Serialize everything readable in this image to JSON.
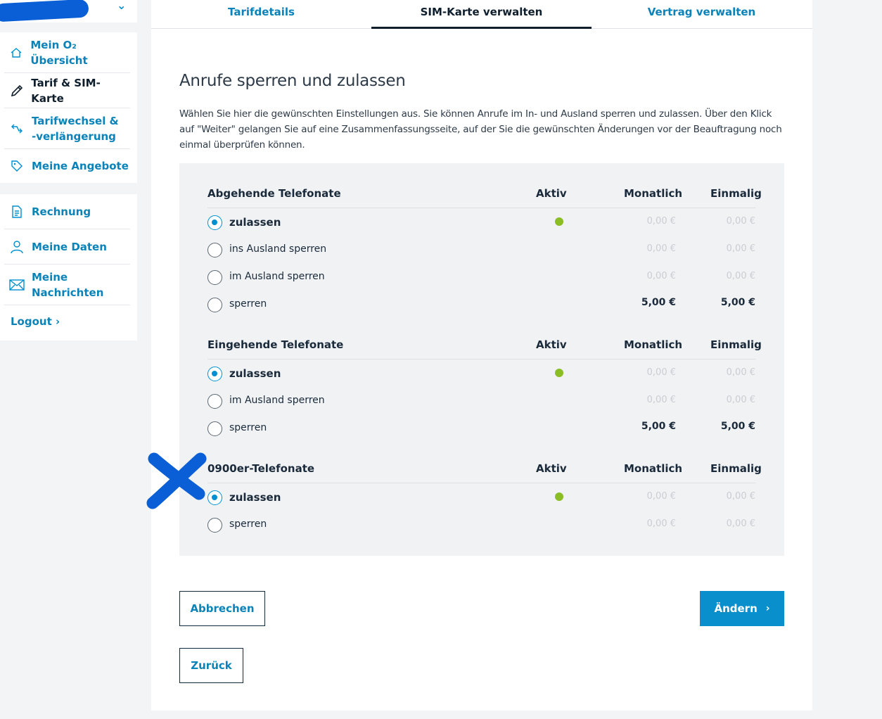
{
  "sidebar": {
    "groups": [
      {
        "items": [
          {
            "label": "Mein O₂ Übersicht",
            "icon": "home-icon"
          },
          {
            "label": "Tarif & SIM-Karte",
            "icon": "pencil-icon",
            "active": true
          },
          {
            "label": "Tarifwechsel & -verlängerung",
            "icon": "switch-icon"
          },
          {
            "label": "Meine Angebote",
            "icon": "tag-icon"
          }
        ]
      },
      {
        "items": [
          {
            "label": "Rechnung",
            "icon": "document-icon"
          },
          {
            "label": "Meine Daten",
            "icon": "person-icon"
          },
          {
            "label": "Meine Nachrichten",
            "icon": "envelope-icon"
          }
        ]
      }
    ],
    "logout": "Logout ›"
  },
  "tabs": [
    {
      "label": "Tarifdetails"
    },
    {
      "label": "SIM-Karte verwalten",
      "active": true
    },
    {
      "label": "Vertrag verwalten"
    }
  ],
  "page": {
    "title": "Anrufe sperren und zulassen",
    "description": "Wählen Sie hier die gewünschten Einstellungen aus. Sie können Anrufe im In- und Ausland sperren und zulassen. Über den Klick auf \"Weiter\" gelangen Sie auf eine Zusammenfassungsseite, auf der Sie die gewünschten Änderungen vor der Beauftragung noch einmal überprüfen können."
  },
  "columns": {
    "aktiv": "Aktiv",
    "monatlich": "Monatlich",
    "einmalig": "Einmalig"
  },
  "sections": [
    {
      "title": "Abgehende Telefonate",
      "options": [
        {
          "label": "zulassen",
          "selected": true,
          "active": true,
          "monatlich": "0,00 €",
          "einmalig": "0,00 €"
        },
        {
          "label": "ins Ausland sperren",
          "monatlich": "0,00 €",
          "einmalig": "0,00 €"
        },
        {
          "label": "im Ausland sperren",
          "monatlich": "0,00 €",
          "einmalig": "0,00 €"
        },
        {
          "label": "sperren",
          "monatlich": "5,00 €",
          "einmalig": "5,00 €",
          "strong": true
        }
      ]
    },
    {
      "title": "Eingehende Telefonate",
      "options": [
        {
          "label": "zulassen",
          "selected": true,
          "active": true,
          "monatlich": "0,00 €",
          "einmalig": "0,00 €"
        },
        {
          "label": "im Ausland sperren",
          "monatlich": "0,00 €",
          "einmalig": "0,00 €"
        },
        {
          "label": "sperren",
          "monatlich": "5,00 €",
          "einmalig": "5,00 €",
          "strong": true
        }
      ]
    },
    {
      "title": "0900er-Telefonate",
      "options": [
        {
          "label": "zulassen",
          "selected": true,
          "active": true,
          "monatlich": "0,00 €",
          "einmalig": "0,00 €"
        },
        {
          "label": "sperren",
          "monatlich": "0,00 €",
          "einmalig": "0,00 €"
        }
      ]
    }
  ],
  "buttons": {
    "cancel": "Abbrechen",
    "change": "Ändern",
    "back": "Zurück"
  },
  "colors": {
    "accent": "#0a8fcd",
    "link": "#0b83b8",
    "active_dot": "#8bbd24",
    "annotation": "#0a5fd6"
  }
}
